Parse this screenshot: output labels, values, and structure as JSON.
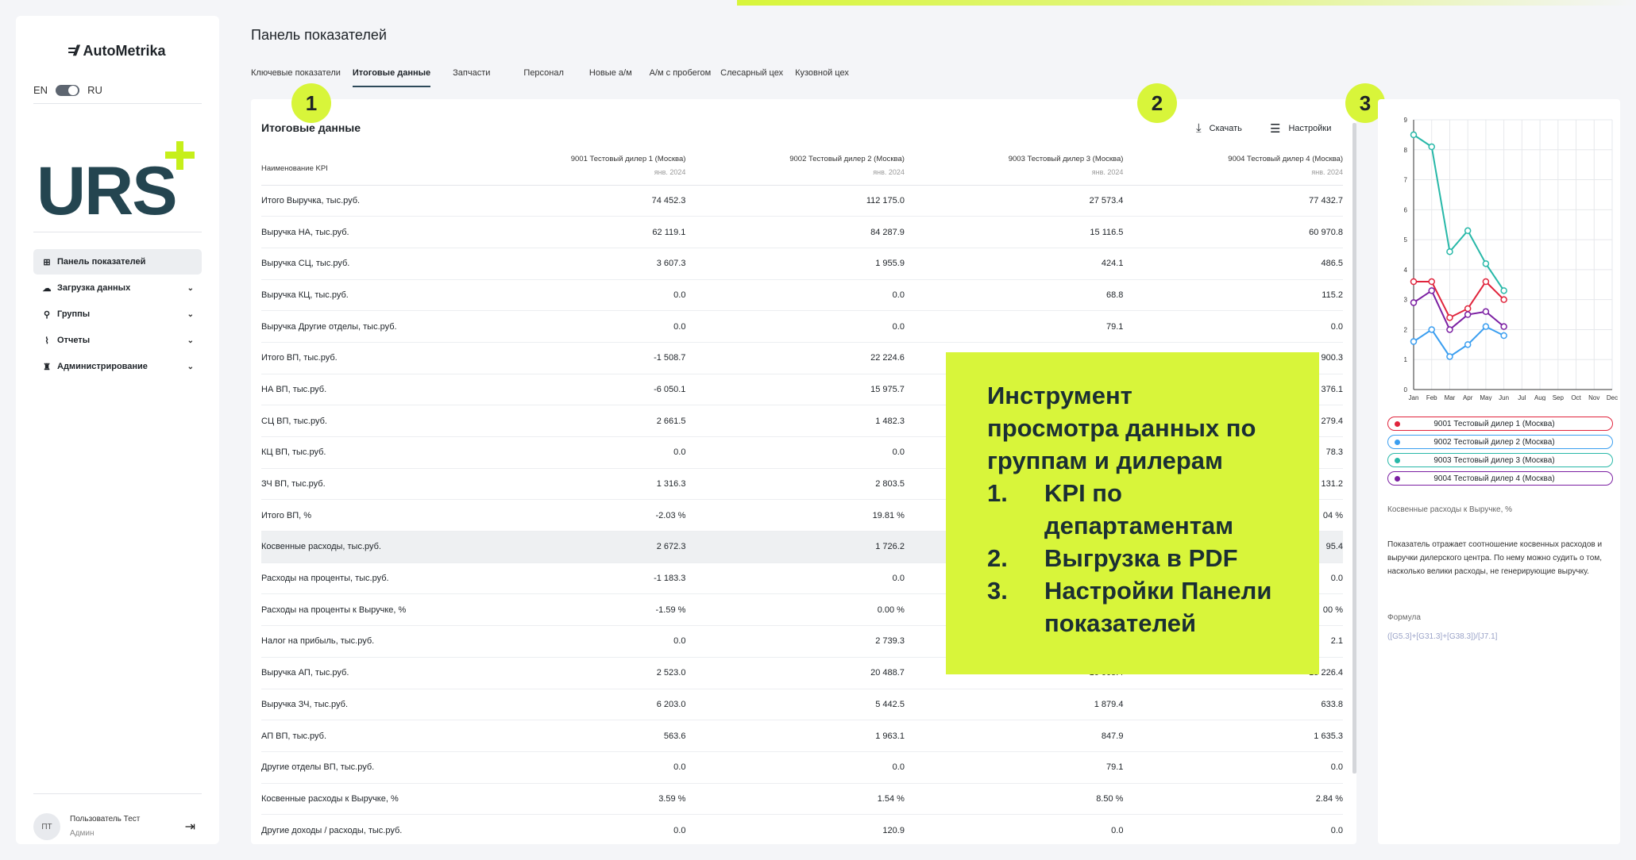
{
  "app": {
    "brand": "AutoMetrika",
    "brand_mark": "=//",
    "logo_text": "URS"
  },
  "lang": {
    "en": "EN",
    "ru": "RU"
  },
  "sidebar": {
    "items": [
      {
        "label": "Панель показателей",
        "icon": "dashboard-icon",
        "active": true
      },
      {
        "label": "Загрузка данных",
        "icon": "cloud-upload-icon"
      },
      {
        "label": "Группы",
        "icon": "groups-icon"
      },
      {
        "label": "Отчеты",
        "icon": "reports-icon"
      },
      {
        "label": "Администрирование",
        "icon": "admin-icon"
      }
    ]
  },
  "user": {
    "initials": "ПТ",
    "name": "Пользователь Тест",
    "role": "Админ"
  },
  "header": {
    "title": "Панель показателей"
  },
  "tabs": [
    "Ключевые показатели",
    "Итоговые данные",
    "Запчасти",
    "Персонал",
    "Новые а/м",
    "А/м с пробегом",
    "Слесарный цех",
    "Кузовной цех"
  ],
  "active_tab": "Итоговые данные",
  "card": {
    "title": "Итоговые данные",
    "download_label": "Скачать",
    "settings_label": "Настройки"
  },
  "table": {
    "kpi_header": "Наименование KPI",
    "columns": [
      {
        "name": "9001 Тестовый дилер 1 (Москва)",
        "period": "янв. 2024"
      },
      {
        "name": "9002 Тестовый дилер 2 (Москва)",
        "period": "янв. 2024"
      },
      {
        "name": "9003 Тестовый дилер 3 (Москва)",
        "period": "янв. 2024"
      },
      {
        "name": "9004 Тестовый дилер 4 (Москва)",
        "period": "янв. 2024"
      }
    ],
    "rows": [
      {
        "kpi": "Итого Выручка, тыс.руб.",
        "values": [
          "74 452.3",
          "112 175.0",
          "27 573.4",
          "77 432.7"
        ]
      },
      {
        "kpi": "Выручка НА, тыс.руб.",
        "values": [
          "62 119.1",
          "84 287.9",
          "15 116.5",
          "60 970.8"
        ]
      },
      {
        "kpi": "Выручка СЦ, тыс.руб.",
        "values": [
          "3 607.3",
          "1 955.9",
          "424.1",
          "486.5"
        ]
      },
      {
        "kpi": "Выручка КЦ, тыс.руб.",
        "values": [
          "0.0",
          "0.0",
          "68.8",
          "115.2"
        ]
      },
      {
        "kpi": "Выручка Другие отделы, тыс.руб.",
        "values": [
          "0.0",
          "0.0",
          "79.1",
          "0.0"
        ]
      },
      {
        "kpi": "Итого ВП, тыс.руб.",
        "values": [
          "-1 508.7",
          "22 224.6",
          "",
          "900.3"
        ]
      },
      {
        "kpi": "НА ВП, тыс.руб.",
        "values": [
          "-6 050.1",
          "15 975.7",
          "",
          "376.1"
        ]
      },
      {
        "kpi": "СЦ ВП, тыс.руб.",
        "values": [
          "2 661.5",
          "1 482.3",
          "",
          "279.4"
        ]
      },
      {
        "kpi": "КЦ ВП, тыс.руб.",
        "values": [
          "0.0",
          "0.0",
          "",
          "78.3"
        ]
      },
      {
        "kpi": "ЗЧ ВП, тыс.руб.",
        "values": [
          "1 316.3",
          "2 803.5",
          "",
          "131.2"
        ]
      },
      {
        "kpi": "Итого ВП, %",
        "values": [
          "-2.03 %",
          "19.81 %",
          "",
          "04 %"
        ]
      },
      {
        "kpi": "Косвенные расходы, тыс.руб.",
        "values": [
          "2 672.3",
          "1 726.2",
          "",
          "95.4"
        ],
        "highlight": true
      },
      {
        "kpi": "Расходы на проценты, тыс.руб.",
        "values": [
          "-1 183.3",
          "0.0",
          "",
          "0.0"
        ]
      },
      {
        "kpi": "Расходы на проценты к Выручке, %",
        "values": [
          "-1.59 %",
          "0.00 %",
          "",
          "00 %"
        ]
      },
      {
        "kpi": "Налог на прибыль, тыс.руб.",
        "values": [
          "0.0",
          "2 739.3",
          "",
          "2.1"
        ]
      },
      {
        "kpi": "Выручка АП, тыс.руб.",
        "values": [
          "2 523.0",
          "20 488.7",
          "10 005.4",
          "15 226.4"
        ]
      },
      {
        "kpi": "Выручка ЗЧ, тыс.руб.",
        "values": [
          "6 203.0",
          "5 442.5",
          "1 879.4",
          "633.8"
        ]
      },
      {
        "kpi": "АП ВП, тыс.руб.",
        "values": [
          "563.6",
          "1 963.1",
          "847.9",
          "1 635.3"
        ]
      },
      {
        "kpi": "Другие отделы ВП, тыс.руб.",
        "values": [
          "0.0",
          "0.0",
          "79.1",
          "0.0"
        ]
      },
      {
        "kpi": "Косвенные расходы к Выручке, %",
        "values": [
          "3.59 %",
          "1.54 %",
          "8.50 %",
          "2.84 %"
        ]
      },
      {
        "kpi": "Другие доходы / расходы, тыс.руб.",
        "values": [
          "0.0",
          "120.9",
          "0.0",
          "0.0"
        ]
      }
    ]
  },
  "markers": [
    "1",
    "2",
    "3"
  ],
  "callout": {
    "title_lines": [
      "Инструмент",
      "просмотра данных по",
      "группам и дилерам"
    ],
    "items": [
      {
        "n": "1.",
        "lines": [
          "KPI по",
          "департаментам"
        ]
      },
      {
        "n": "2.",
        "lines": [
          "Выгрузка в PDF"
        ]
      },
      {
        "n": "3.",
        "lines": [
          "Настройки Панели",
          "показателей"
        ]
      }
    ]
  },
  "right_panel": {
    "kpi_title": "Косвенные расходы к Выручке, %",
    "description": "Показатель отражает соотношение косвенных расходов и выручки дилерского центра. По нему можно судить о том, насколько велики расходы, не генерирующие выручку.",
    "formula_label": "Формула",
    "formula": "([G5.3]+[G31.3]+[G38.3])/[J7.1]"
  },
  "chart_data": {
    "type": "line",
    "x": [
      "Jan",
      "Feb",
      "Mar",
      "Apr",
      "May",
      "Jun",
      "Jul",
      "Aug",
      "Sep",
      "Oct",
      "Nov",
      "Dec"
    ],
    "ylim": [
      0,
      9
    ],
    "yticks": [
      "0",
      "1",
      "2",
      "3",
      "4",
      "5",
      "6",
      "7",
      "8",
      "9"
    ],
    "grid": true,
    "series": [
      {
        "name": "9001 Тестовый дилер 1 (Москва)",
        "color": "#e0243c",
        "values": [
          3.6,
          3.6,
          2.4,
          2.7,
          3.6,
          3.0
        ]
      },
      {
        "name": "9002 Тестовый дилер 2 (Москва)",
        "color": "#3a9ef0",
        "values": [
          1.6,
          2.0,
          1.1,
          1.5,
          2.1,
          1.8
        ]
      },
      {
        "name": "9003 Тестовый дилер 3 (Москва)",
        "color": "#27b8a8",
        "values": [
          8.5,
          8.1,
          4.6,
          5.3,
          4.2,
          3.3
        ]
      },
      {
        "name": "9004 Тестовый дилер 4 (Москва)",
        "color": "#7b1fa2",
        "values": [
          2.9,
          3.3,
          2.0,
          2.5,
          2.6,
          2.1
        ]
      }
    ]
  }
}
